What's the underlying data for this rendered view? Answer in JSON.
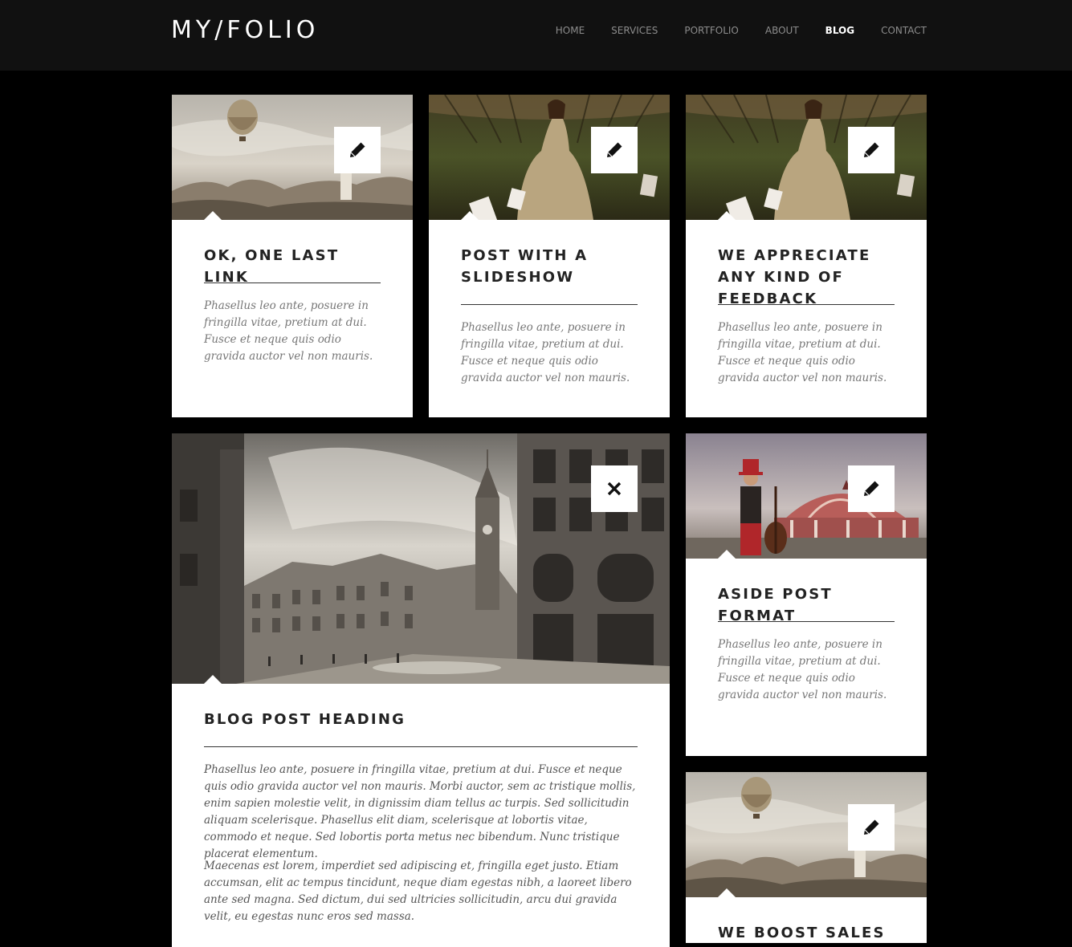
{
  "site": {
    "logo": "MY/FOLIO",
    "nav": [
      "HOME",
      "SERVICES",
      "PORTFOLIO",
      "ABOUT",
      "BLOG",
      "CONTACT"
    ],
    "active_nav": "BLOG"
  },
  "posts": [
    {
      "title": "OK, ONE LAST LINK",
      "excerpt": "Phasellus leo ante, posuere in fringilla vitae, pretium at dui. Fusce et neque quis odio gravida auctor vel non mauris.",
      "icon": "pencil-icon"
    },
    {
      "title": "POST WITH A SLIDESHOW",
      "excerpt": "Phasellus leo ante, posuere in fringilla vitae, pretium at dui. Fusce et neque quis odio gravida auctor vel non mauris.",
      "icon": "pencil-icon"
    },
    {
      "title": "WE APPRECIATE ANY KIND OF FEEDBACK",
      "excerpt": "Phasellus leo ante, posuere in fringilla vitae, pretium at dui. Fusce et neque quis odio gravida auctor vel non mauris.",
      "icon": "pencil-icon"
    },
    {
      "title": "BLOG POST HEADING",
      "paragraphs": [
        "Phasellus leo ante, posuere in fringilla vitae, pretium at dui. Fusce et neque quis odio gravida auctor vel non mauris. Morbi auctor, sem ac tristique mollis, enim sapien molestie velit, in dignissim diam tellus ac turpis. Sed sollicitudin aliquam scelerisque. Phasellus elit diam, scelerisque at lobortis vitae, commodo et neque. Sed lobortis porta metus nec bibendum. Nunc tristique placerat elementum.",
        "Maecenas est lorem, imperdiet sed adipiscing et, fringilla eget justo. Etiam accumsan, elit ac tempus tincidunt, neque diam egestas nibh, a laoreet libero ante sed magna. Sed dictum, dui sed ultricies sollicitudin, arcu dui gravida velit, eu egestas nunc eros sed massa."
      ],
      "icon": "close-icon"
    },
    {
      "title": "ASIDE POST FORMAT",
      "excerpt": "Phasellus leo ante, posuere in fringilla vitae, pretium at dui. Fusce et neque quis odio gravida auctor vel non mauris.",
      "icon": "pencil-icon"
    },
    {
      "title": "WE BOOST SALES",
      "icon": "pencil-icon"
    }
  ]
}
